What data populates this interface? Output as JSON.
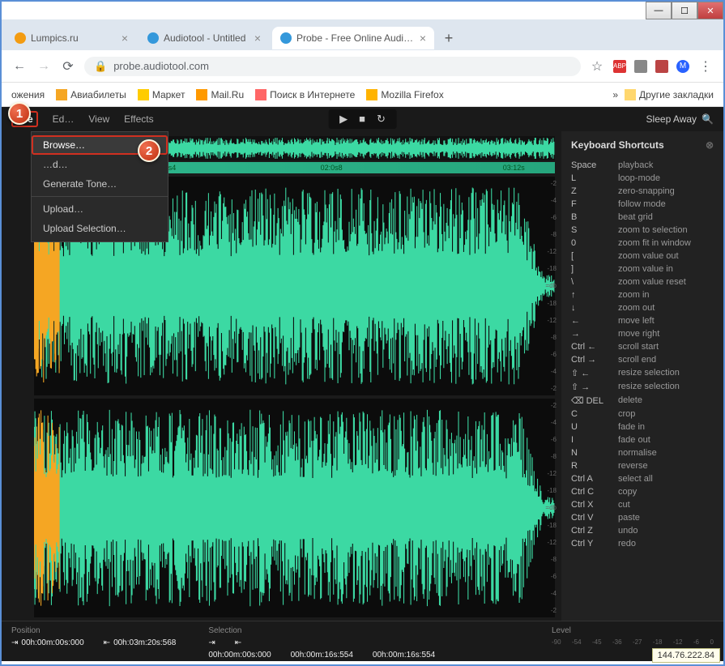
{
  "window": {
    "min": "—",
    "max": "☐",
    "close": "✕"
  },
  "tabs": [
    {
      "title": "Lumpics.ru",
      "favicon": "#f39c12"
    },
    {
      "title": "Audiotool - Untitled",
      "favicon": "#3498db"
    },
    {
      "title": "Probe - Free Online Audio Samp",
      "favicon": "#3498db",
      "active": true
    }
  ],
  "newTab": "+",
  "addr": {
    "back": "←",
    "fwd": "→",
    "reload": "⟳",
    "lock": "🔒",
    "url": "probe.audiotool.com",
    "star": "☆",
    "menu": "⋮"
  },
  "ext_labels": {
    "abp": "ABP",
    "m": "M"
  },
  "bookmarks": {
    "apps_partial": "ожения",
    "items": [
      "Авиабилеты",
      "Маркет",
      "Mail.Ru",
      "Поиск в Интернете",
      "Mozilla Firefox"
    ],
    "overflow": "»",
    "other": "Другие закладки"
  },
  "menu": {
    "file": "File",
    "edit": "Ed…",
    "view": "View",
    "effects": "Effects"
  },
  "transport": {
    "play": "▶",
    "stop": "■",
    "loop": "↻"
  },
  "sleepAway": "Sleep Away",
  "fileMenu": {
    "browse": "Browse…",
    "record_cut": "…d…",
    "generate": "Generate Tone…",
    "upload": "Upload…",
    "uploadSel": "Upload Selection…"
  },
  "timeline": {
    "t0": "0s4",
    "t1": "02:0s8",
    "t2": "03:12s"
  },
  "dbMarks": [
    "-2",
    "-4",
    "-6",
    "-8",
    "-12",
    "-18",
    "=db",
    "-18",
    "-12",
    "-8",
    "-6",
    "-4",
    "-2"
  ],
  "shortcuts": {
    "title": "Keyboard Shortcuts",
    "close": "⊗",
    "rows": [
      {
        "k": "Space",
        "d": "playback"
      },
      {
        "k": "L",
        "d": "loop-mode"
      },
      {
        "k": "Z",
        "d": "zero-snapping"
      },
      {
        "k": "F",
        "d": "follow mode"
      },
      {
        "k": "B",
        "d": "beat grid"
      },
      {
        "k": "S",
        "d": "zoom to selection"
      },
      {
        "k": "0",
        "d": "zoom fit in window"
      },
      {
        "k": "[",
        "d": "zoom value out"
      },
      {
        "k": "]",
        "d": "zoom value in"
      },
      {
        "k": "\\",
        "d": "zoom value reset"
      },
      {
        "k": "↑",
        "d": "zoom in"
      },
      {
        "k": "↓",
        "d": "zoom out"
      },
      {
        "k": "←",
        "d": "move left"
      },
      {
        "k": "→",
        "d": "move right"
      },
      {
        "k": "Ctrl ←",
        "d": "scroll start"
      },
      {
        "k": "Ctrl →",
        "d": "scroll end"
      },
      {
        "k": "⇧ ←",
        "d": "resize selection"
      },
      {
        "k": "⇧ →",
        "d": "resize selection"
      },
      {
        "k": "⌫ DEL",
        "d": "delete"
      },
      {
        "k": "C",
        "d": "crop"
      },
      {
        "k": "U",
        "d": "fade in"
      },
      {
        "k": "I",
        "d": "fade out"
      },
      {
        "k": "N",
        "d": "normalise"
      },
      {
        "k": "R",
        "d": "reverse"
      },
      {
        "k": "Ctrl A",
        "d": "select all"
      },
      {
        "k": "Ctrl C",
        "d": "copy"
      },
      {
        "k": "Ctrl X",
        "d": "cut"
      },
      {
        "k": "Ctrl V",
        "d": "paste"
      },
      {
        "k": "Ctrl Z",
        "d": "undo"
      },
      {
        "k": "Ctrl Y",
        "d": "redo"
      }
    ]
  },
  "status": {
    "position": {
      "label": "Position",
      "start": "00h:00m:00s:000",
      "end": "00h:03m:20s:568"
    },
    "selection": {
      "label": "Selection",
      "a": "00h:00m:00s:000",
      "b": "00h:00m:16s:554",
      "c": "00h:00m:16s:554"
    },
    "level": {
      "label": "Level",
      "marks": [
        "-90",
        "-54",
        "-45",
        "-36",
        "-27",
        "-18",
        "-12",
        "-6",
        "0"
      ]
    }
  },
  "markers": {
    "one": "1",
    "two": "2"
  },
  "ip": "144.76.222.84",
  "icons": {
    "marker_start": "⇥",
    "marker_end": "⇤",
    "search": "🔍"
  }
}
